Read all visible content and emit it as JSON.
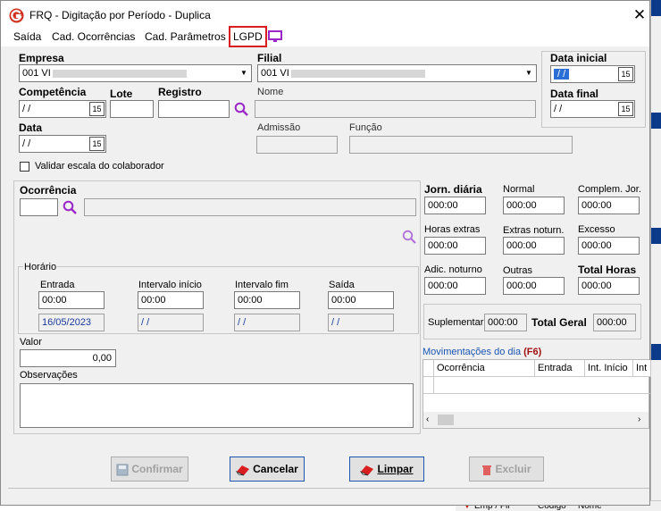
{
  "window": {
    "title": "FRQ - Digitação por Período - Duplica",
    "close": "✕"
  },
  "menu": [
    "Saída",
    "Cad. Ocorrências",
    "Cad. Parâmetros",
    "LGPD"
  ],
  "empresa": {
    "label": "Empresa",
    "value": "001 VI"
  },
  "filial": {
    "label": "Filial",
    "value": "001 VI"
  },
  "data_inicial": {
    "label": "Data inicial",
    "value": " / /"
  },
  "data_final": {
    "label": "Data final",
    "value": " / /"
  },
  "competencia": {
    "label": "Competência",
    "value": " / /"
  },
  "lote": {
    "label": "Lote",
    "value": ""
  },
  "registro": {
    "label": "Registro",
    "value": ""
  },
  "nome": {
    "label": "Nome",
    "value": ""
  },
  "data": {
    "label": "Data",
    "value": " / /"
  },
  "admissao": {
    "label": "Admissão",
    "value": ""
  },
  "funcao": {
    "label": "Função",
    "value": ""
  },
  "validar_escala": {
    "label": "Validar escala do colaborador",
    "checked": false
  },
  "ocorrencia": {
    "label": "Ocorrência",
    "code": "",
    "desc": ""
  },
  "horario": {
    "title": "Horário",
    "entrada": {
      "label": "Entrada",
      "time": "00:00",
      "date": "16/05/2023"
    },
    "intervalo_inicio": {
      "label": "Intervalo início",
      "time": "00:00",
      "date": " / /"
    },
    "intervalo_fim": {
      "label": "Intervalo fim",
      "time": "00:00",
      "date": " / /"
    },
    "saida": {
      "label": "Saída",
      "time": "00:00",
      "date": " / /"
    }
  },
  "valor": {
    "label": "Valor",
    "value": "0,00"
  },
  "observacoes": {
    "label": "Observações",
    "value": ""
  },
  "totais": {
    "jorn_diaria": {
      "label": "Jorn. diária",
      "value": "000:00"
    },
    "normal": {
      "label": "Normal",
      "value": "000:00"
    },
    "complem_jor": {
      "label": "Complem. Jor.",
      "value": "000:00"
    },
    "horas_extras": {
      "label": "Horas extras",
      "value": "000:00"
    },
    "extras_noturn": {
      "label": "Extras noturn.",
      "value": "000:00"
    },
    "excesso": {
      "label": "Excesso",
      "value": "000:00"
    },
    "adic_noturno": {
      "label": "Adic. noturno",
      "value": "000:00"
    },
    "outras": {
      "label": "Outras",
      "value": "000:00"
    },
    "total_horas": {
      "label": "Total Horas",
      "value": "000:00"
    },
    "suplementar": {
      "label": "Suplementar",
      "value": "000:00"
    },
    "total_geral": {
      "label": "Total Geral",
      "value": "000:00"
    }
  },
  "movimentacoes": {
    "title": "Movimentações do dia",
    "shortcut": "(F6)",
    "columns": [
      "Ocorrência",
      "Entrada",
      "Int. Início",
      "Int"
    ]
  },
  "buttons": {
    "confirmar": "Confirmar",
    "cancelar": "Cancelar",
    "limpar": "Limpar",
    "excluir": "Excluir"
  },
  "bg_app": {
    "col1": "Emp / Fil",
    "col2": "Código",
    "col3": "Nome"
  },
  "colors": {
    "accent_purple": "#9b27c9",
    "highlight_red": "#d81e1e",
    "focus_blue": "#1a55b0",
    "title_red": "#d03020",
    "shortcut_red": "#a01010"
  }
}
